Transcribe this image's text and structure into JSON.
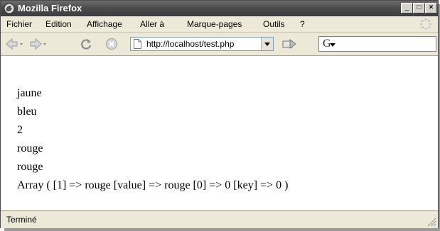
{
  "window": {
    "title": "Mozilla Firefox"
  },
  "menu": [
    {
      "label": "Fichier"
    },
    {
      "label": "Edition"
    },
    {
      "label": "Affichage"
    },
    {
      "label": "Aller à"
    },
    {
      "label": "Marque-pages"
    },
    {
      "label": "Outils"
    },
    {
      "label": "?"
    }
  ],
  "navigation": {
    "url": "http://localhost/test.php",
    "search_engine_icon": "google-icon"
  },
  "content": {
    "lines": [
      "jaune",
      "bleu",
      "2",
      "rouge",
      "rouge",
      "Array ( [1] => rouge [value] => rouge [0] => 0 [key] => 0 )"
    ]
  },
  "status": {
    "text": "Terminé"
  },
  "colors": {
    "titlebar": "#4c4c4c",
    "chrome": "#ece9d8",
    "content": "#ffffff"
  }
}
